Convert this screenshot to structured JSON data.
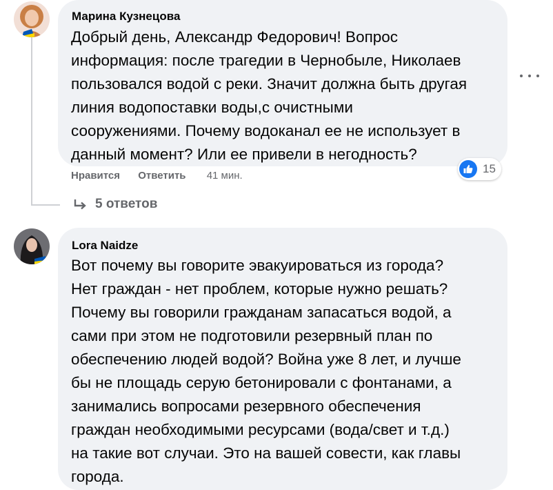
{
  "comments": [
    {
      "author": "Марина Кузнецова",
      "text": "Добрый день, Александр Федорович! Вопрос\nинформация: после трагедии в Чернобыле, Николаев\nпользовался водой с реки. Значит должна быть другая\nлиния водопоставки воды,с очистными\nсооружениями. Почему водоканал ее не использует в\nданный момент? Или ее привели в негодность?",
      "like_label": "Нравится",
      "reply_label": "Ответить",
      "time": "41 мин.",
      "reaction_icon": "like-icon",
      "reaction_count": "15",
      "replies_label": "5 ответов"
    },
    {
      "author": "Lora Naidze",
      "text": "Вот почему вы говорите эвакуироваться из города?\nНет граждан - нет проблем, которые нужно решать?\nПочему вы говорили гражданам запасаться водой, а\nсами при этом не подготовили резервный план по\nобеспечению людей водой? Война уже 8 лет, и лучше\nбы не площадь серую бетонировали с фонтанами, а\nзанимались вопросами резервного обеспечения\nграждан необходимыми ресурсами (вода/свет и т.д.)\nна такие вот случаи. Это на вашей совести, как главы\nгорода."
    }
  ],
  "icons": {
    "more": "more-options-icon",
    "reply_arrow": "reply-arrow-icon"
  },
  "colors": {
    "bubble": "#f0f2f5",
    "secondary_text": "#65676b",
    "like_blue": "#1877f2",
    "flag_blue": "#0057b7",
    "flag_yellow": "#ffd700"
  }
}
